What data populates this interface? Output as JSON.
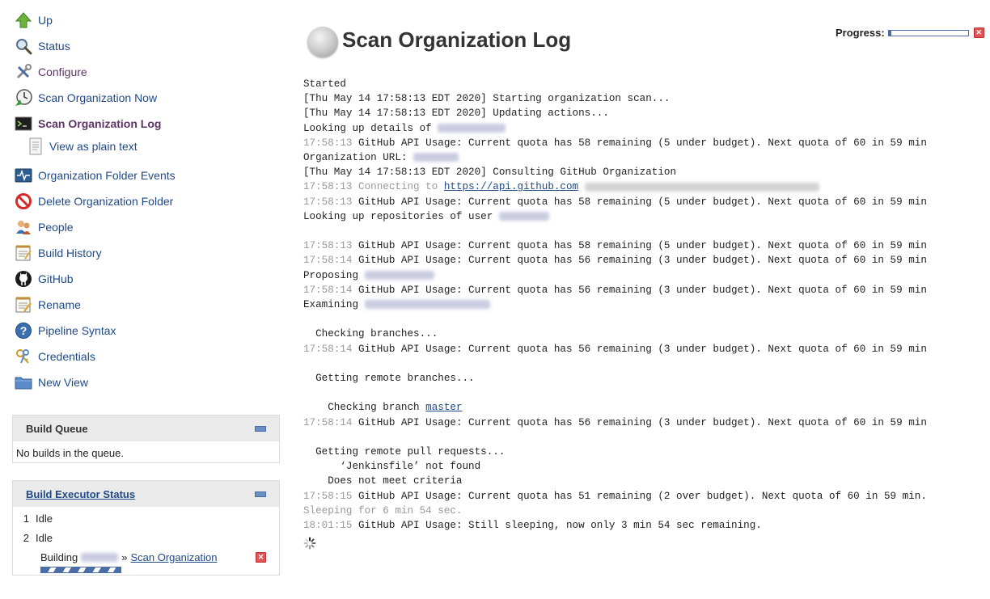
{
  "sidebar": {
    "items": [
      {
        "label": "Up",
        "icon": "up-arrow-icon"
      },
      {
        "label": "Status",
        "icon": "magnifier-icon"
      },
      {
        "label": "Configure",
        "icon": "tools-icon"
      },
      {
        "label": "Scan Organization Now",
        "icon": "clock-run-icon"
      },
      {
        "label": "Scan Organization Log",
        "icon": "terminal-icon"
      },
      {
        "label": "View as plain text",
        "icon": "document-icon"
      },
      {
        "label": "Organization Folder Events",
        "icon": "monitor-icon"
      },
      {
        "label": "Delete Organization Folder",
        "icon": "no-entry-icon"
      },
      {
        "label": "People",
        "icon": "people-icon"
      },
      {
        "label": "Build History",
        "icon": "notepad-icon"
      },
      {
        "label": "GitHub",
        "icon": "github-icon"
      },
      {
        "label": "Rename",
        "icon": "notepad-pencil-icon"
      },
      {
        "label": "Pipeline Syntax",
        "icon": "help-icon"
      },
      {
        "label": "Credentials",
        "icon": "keys-icon"
      },
      {
        "label": "New View",
        "icon": "folder-icon"
      }
    ]
  },
  "build_queue": {
    "title": "Build Queue",
    "empty_text": "No builds in the queue."
  },
  "executor_status": {
    "title": "Build Executor Status",
    "executors": [
      {
        "number": "1",
        "state": "Idle"
      },
      {
        "number": "2",
        "state": "Idle"
      }
    ],
    "building_prefix": "Building",
    "separator": "»",
    "job_link": "Scan Organization",
    "progress_fraction": 1.0
  },
  "header": {
    "title": "Scan Organization Log",
    "progress_label": "Progress:",
    "progress_fraction": 0.03
  },
  "log": {
    "lines": [
      "Started",
      "[Thu May 14 17:58:13 EDT 2020] Starting organization scan...",
      "[Thu May 14 17:58:13 EDT 2020] Updating actions...",
      "Looking up details of ",
      "17:58:13 GitHub API Usage: Current quota has 58 remaining (5 under budget). Next quota of 60 in 59 min",
      "Organization URL: ",
      "[Thu May 14 17:58:13 EDT 2020] Consulting GitHub Organization",
      "17:58:13 Connecting to https://api.github.com",
      "17:58:13 GitHub API Usage: Current quota has 58 remaining (5 under budget). Next quota of 60 in 59 min",
      "Looking up repositories of user ",
      "",
      "17:58:13 GitHub API Usage: Current quota has 58 remaining (5 under budget). Next quota of 60 in 59 min",
      "17:58:14 GitHub API Usage: Current quota has 56 remaining (3 under budget). Next quota of 60 in 59 min",
      "Proposing ",
      "17:58:14 GitHub API Usage: Current quota has 56 remaining (3 under budget). Next quota of 60 in 59 min",
      "Examining ",
      "",
      "  Checking branches...",
      "17:58:14 GitHub API Usage: Current quota has 56 remaining (3 under budget). Next quota of 60 in 59 min",
      "",
      "  Getting remote branches...",
      "",
      "    Checking branch master",
      "17:58:14 GitHub API Usage: Current quota has 56 remaining (3 under budget). Next quota of 60 in 59 min",
      "",
      "  Getting remote pull requests...",
      "      ‘Jenkinsfile’ not found",
      "    Does not meet criteria",
      "17:58:15 GitHub API Usage: Current quota has 51 remaining (2 over budget). Next quota of 60 in 59 min.",
      "Sleeping for 6 min 54 sec.",
      "18:01:15 GitHub API Usage: Still sleeping, now only 3 min 54 sec remaining."
    ],
    "api_url": "https://api.github.com",
    "branch": "master"
  },
  "colors": {
    "link": "#204a87",
    "visited": "#5c3566",
    "timestamp": "#999999",
    "accent": "#4a6da5"
  }
}
